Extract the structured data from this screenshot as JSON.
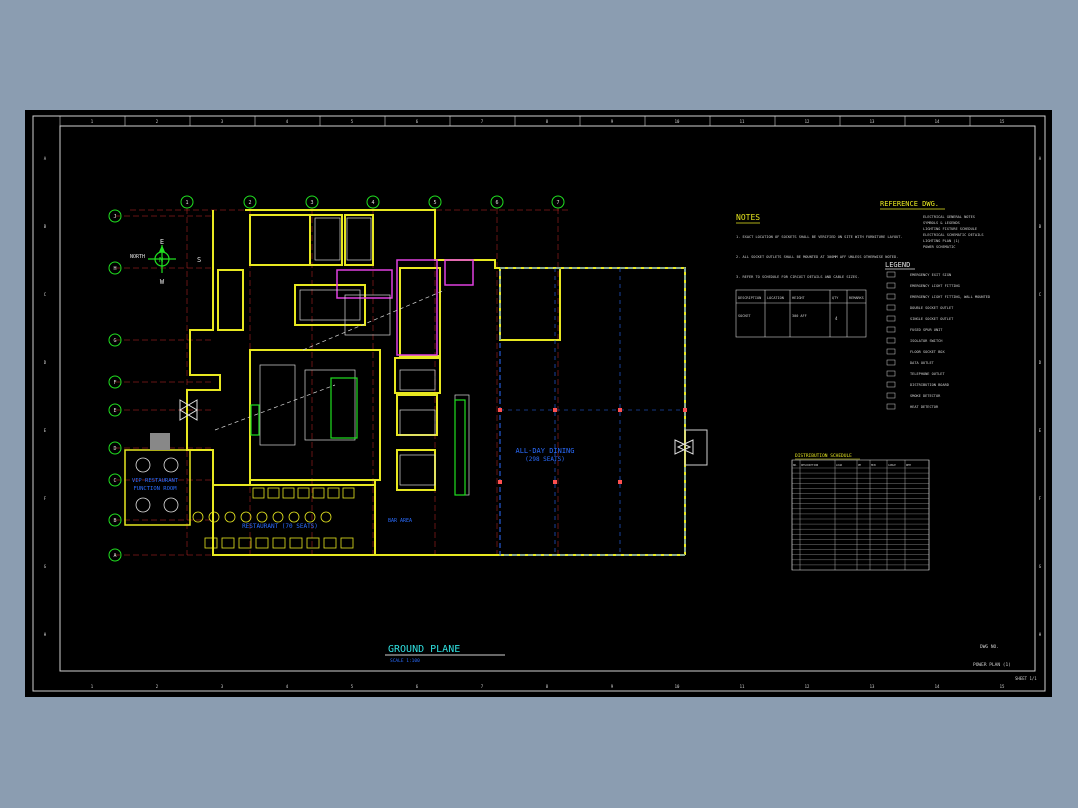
{
  "drawing": {
    "title": "GROUND PLANE",
    "scale": "SCALE 1:100",
    "sheet_id": "DWG NO.",
    "sheet_ref": "POWER PLAN (1)",
    "sheet_code": "SHEET 1/1"
  },
  "grid": {
    "columns": [
      "1",
      "2",
      "3",
      "4",
      "5",
      "6",
      "7",
      "8"
    ],
    "rows": [
      "J",
      "H",
      "G",
      "F",
      "E",
      "D",
      "C",
      "B",
      "A"
    ],
    "border_numbers": [
      "1",
      "2",
      "3",
      "4",
      "5",
      "6",
      "7",
      "8",
      "9",
      "10",
      "11",
      "12",
      "13",
      "14",
      "15"
    ],
    "border_letters": [
      "A",
      "B",
      "C",
      "D",
      "E",
      "F",
      "G",
      "H"
    ]
  },
  "compass": {
    "n": "N",
    "e": "E",
    "s": "S",
    "w": "W",
    "north_label": "NORTH"
  },
  "notes": {
    "title": "NOTES",
    "items": [
      "1. EXACT LOCATION OF SOCKETS SHALL BE VERIFIED ON SITE WITH FURNITURE LAYOUT.",
      "2. ALL SOCKET OUTLETS SHALL BE MOUNTED AT 300MM AFF UNLESS OTHERWISE NOTED.",
      "3. REFER TO SCHEDULE FOR CIRCUIT DETAILS AND CABLE SIZES."
    ],
    "table_headers": [
      "DESCRIPTION",
      "LOCATION",
      "HEIGHT",
      "QTY",
      "REMARKS"
    ],
    "table_row": [
      "SOCKET",
      "",
      "300 AFF",
      "4",
      ""
    ]
  },
  "reference": {
    "title": "REFERENCE DWG.",
    "items": [
      "ELECTRICAL GENERAL NOTES",
      "SYMBOLS & LEGENDS",
      "LIGHTING FIXTURE SCHEDULE",
      "ELECTRICAL SCHEMATIC DETAILS",
      "LIGHTING PLAN (1)",
      "POWER SCHEMATIC"
    ]
  },
  "legend": {
    "title": "LEGEND",
    "items": [
      "EMERGENCY EXIT SIGN",
      "EMERGENCY LIGHT FITTING",
      "EMERGENCY LIGHT FITTING, WALL MOUNTED",
      "DOUBLE SOCKET OUTLET",
      "SINGLE SOCKET OUTLET",
      "FUSED SPUR UNIT",
      "ISOLATOR SWITCH",
      "FLOOR SOCKET BOX",
      "DATA OUTLET",
      "TELEPHONE OUTLET",
      "DISTRIBUTION BOARD",
      "SMOKE DETECTOR",
      "HEAT DETECTOR"
    ]
  },
  "schedule": {
    "title": "DISTRIBUTION SCHEDULE",
    "headers": [
      "NO.",
      "DESCRIPTION",
      "LOAD",
      "PH",
      "MCB",
      "CABLE",
      "REM"
    ]
  },
  "rooms": [
    {
      "label": "ALL-DAY DINING",
      "sub": "(298 SEATS)"
    },
    {
      "label": "VIP RESTAURANT",
      "sub": "FUNCTION ROOM"
    },
    {
      "label": "RESTAURANT (70 SEATS)",
      "sub": ""
    },
    {
      "label": "BAR AREA",
      "sub": ""
    }
  ],
  "colors": {
    "background": "#8b9db1",
    "sheet": "#000000",
    "wall": "#e8e820",
    "grid": "#20e020",
    "text": "#e0e0e0",
    "title": "#30e0e0",
    "accent": "#2a6cff",
    "red": "#ff3030"
  }
}
